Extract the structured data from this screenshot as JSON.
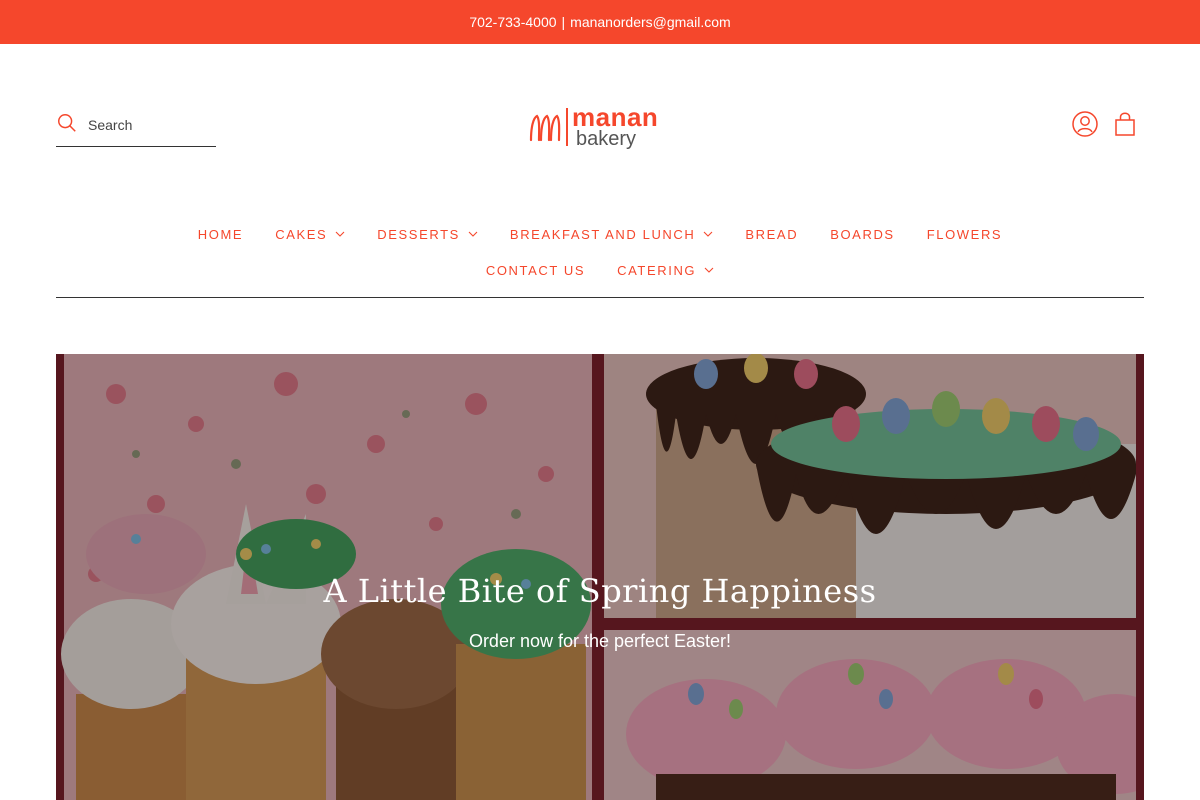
{
  "announcement": {
    "phone": "702-733-4000",
    "separator": "|",
    "email": "mananorders@gmail.com"
  },
  "header": {
    "search": {
      "placeholder": "Search",
      "icon": "search-icon"
    },
    "logo": {
      "word1": "manan",
      "word2": "bakery"
    },
    "icons": {
      "account": "account-icon",
      "cart": "cart-icon"
    }
  },
  "nav": {
    "row1": [
      {
        "label": "HOME",
        "dropdown": false
      },
      {
        "label": "CAKES",
        "dropdown": true
      },
      {
        "label": "DESSERTS",
        "dropdown": true
      },
      {
        "label": "BREAKFAST AND LUNCH",
        "dropdown": true
      },
      {
        "label": "BREAD",
        "dropdown": false
      },
      {
        "label": "BOARDS",
        "dropdown": false
      },
      {
        "label": "FLOWERS",
        "dropdown": false
      }
    ],
    "row2": [
      {
        "label": "CONTACT US",
        "dropdown": false
      },
      {
        "label": "CATERING",
        "dropdown": true
      }
    ]
  },
  "hero": {
    "title": "A Little Bite of Spring Happiness",
    "subtitle": "Order now for the perfect Easter!"
  },
  "colors": {
    "brand": "#f5472c",
    "text": "#333333",
    "background": "#ffffff"
  }
}
